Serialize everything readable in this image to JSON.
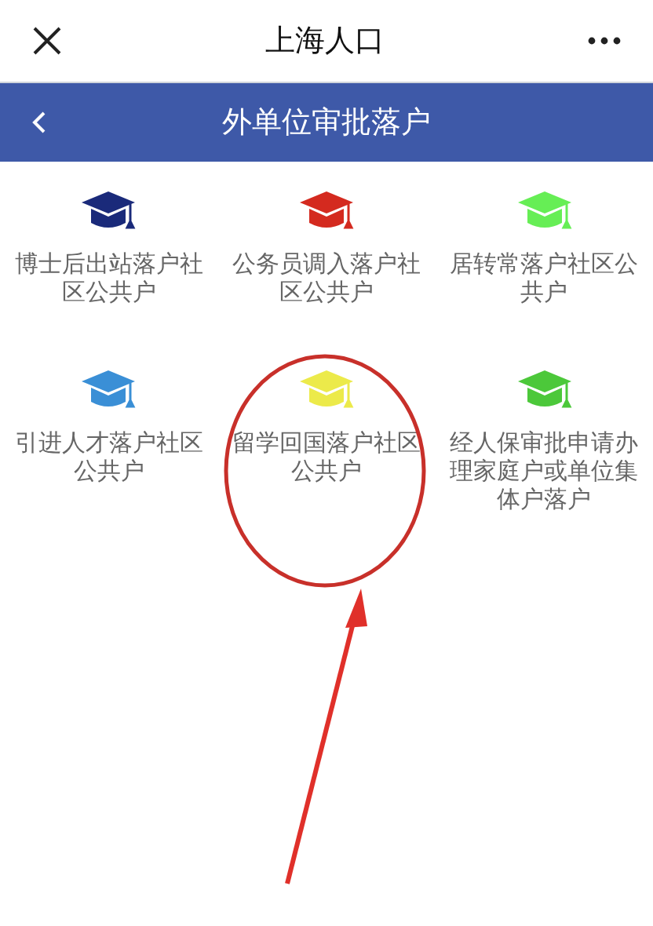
{
  "top_bar": {
    "title": "上海人口"
  },
  "header": {
    "title": "外单位审批落户"
  },
  "items": [
    {
      "label": "博士后出站落户社区公共户",
      "color": "#1a2a7a"
    },
    {
      "label": "公务员调入落户社区公共户",
      "color": "#d42a1f"
    },
    {
      "label": "居转常落户社区公共户",
      "color": "#66ee55"
    },
    {
      "label": "引进人才落户社区公共户",
      "color": "#3a8fd6"
    },
    {
      "label": "留学回国落户社区公共户",
      "color": "#ecea4a"
    },
    {
      "label": "经人保审批申请办理家庭户或单位集体户落户",
      "color": "#4cc83a"
    }
  ]
}
